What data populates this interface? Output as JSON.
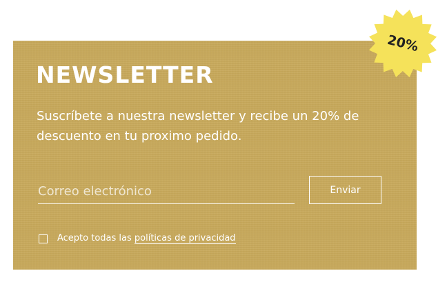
{
  "newsletter": {
    "title": "NEWSLETTER",
    "description": "Suscríbete a nuestra newsletter y recibe un 20% de descuento en tu proximo pedido.",
    "email_placeholder": "Correo electrónico",
    "email_value": "",
    "submit_label": "Enviar",
    "consent_prefix": "Acepto todas las ",
    "consent_link": "políticas de privacidad",
    "consent_checked": false
  },
  "badge": {
    "label": "20%",
    "color": "#f5e25a"
  },
  "colors": {
    "card_background": "#c8a95a",
    "text": "#ffffff",
    "badge_text": "#222222"
  }
}
